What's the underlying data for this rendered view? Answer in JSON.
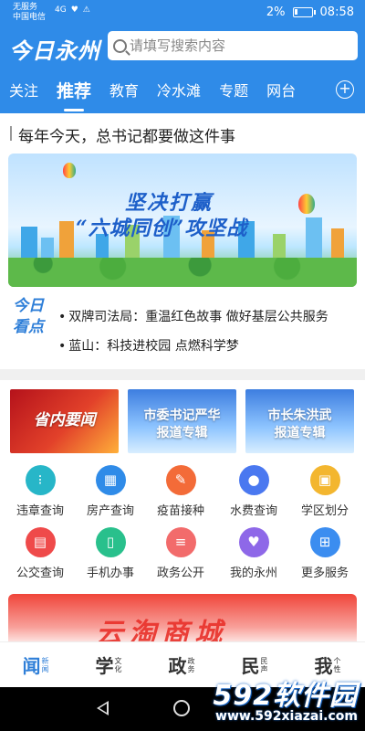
{
  "statusbar": {
    "carrier_line1": "无服务",
    "carrier_line2": "中国电信",
    "signal": "4G",
    "battery": "2%",
    "time": "08:58"
  },
  "header": {
    "logo": "今日永州",
    "search_placeholder": "请填写搜索内容"
  },
  "tabs": [
    {
      "label": "关注",
      "active": false
    },
    {
      "label": "推荐",
      "active": true
    },
    {
      "label": "教育",
      "active": false
    },
    {
      "label": "冷水滩",
      "active": false
    },
    {
      "label": "专题",
      "active": false
    },
    {
      "label": "网台",
      "active": false
    }
  ],
  "headline": "每年今天，总书记都要做这件事",
  "banner": {
    "line1": "坚决打赢",
    "line2": "“六城同创”攻坚战"
  },
  "today": {
    "logo": "今日看点",
    "items": [
      "双牌司法局：重温红色故事 做好基层公共服务",
      "蓝山：科技进校园 点燃科学梦"
    ]
  },
  "col_banners": [
    {
      "label": "省内要闻"
    },
    {
      "label": "市委书记严华报道专辑",
      "line1": "市委书记严华",
      "line2": "报道专辑"
    },
    {
      "label": "市长朱洪武报道专辑",
      "line1": "市长朱洪武",
      "line2": "报道专辑"
    }
  ],
  "services": [
    {
      "label": "违章查询",
      "icon": "traffic-light-icon",
      "color": "#27b6c8"
    },
    {
      "label": "房产查询",
      "icon": "building-icon",
      "color": "#2f8be8"
    },
    {
      "label": "疫苗接种",
      "icon": "syringe-icon",
      "color": "#f36b38"
    },
    {
      "label": "水费查询",
      "icon": "water-drop-icon",
      "color": "#4a78f0"
    },
    {
      "label": "学区划分",
      "icon": "school-icon",
      "color": "#f3b62f"
    },
    {
      "label": "公交查询",
      "icon": "bus-icon",
      "color": "#ef4a4a"
    },
    {
      "label": "手机办事",
      "icon": "phone-icon",
      "color": "#29c08c"
    },
    {
      "label": "政务公开",
      "icon": "document-icon",
      "color": "#f26b6b"
    },
    {
      "label": "我的永州",
      "icon": "heart-hand-icon",
      "color": "#8e68e8"
    },
    {
      "label": "更多服务",
      "icon": "grid-icon",
      "color": "#3b8df0"
    }
  ],
  "ad_text": "云淘商城",
  "bottom_nav": [
    {
      "big": "闻",
      "small": "新闻",
      "active": true
    },
    {
      "big": "学",
      "small": "文化",
      "active": false
    },
    {
      "big": "政",
      "small": "政务",
      "active": false
    },
    {
      "big": "民",
      "small": "民声",
      "active": false
    },
    {
      "big": "我",
      "small": "个性",
      "active": false
    }
  ],
  "watermark": {
    "brand": "592软件园",
    "url": "www.592xiazai.com"
  }
}
